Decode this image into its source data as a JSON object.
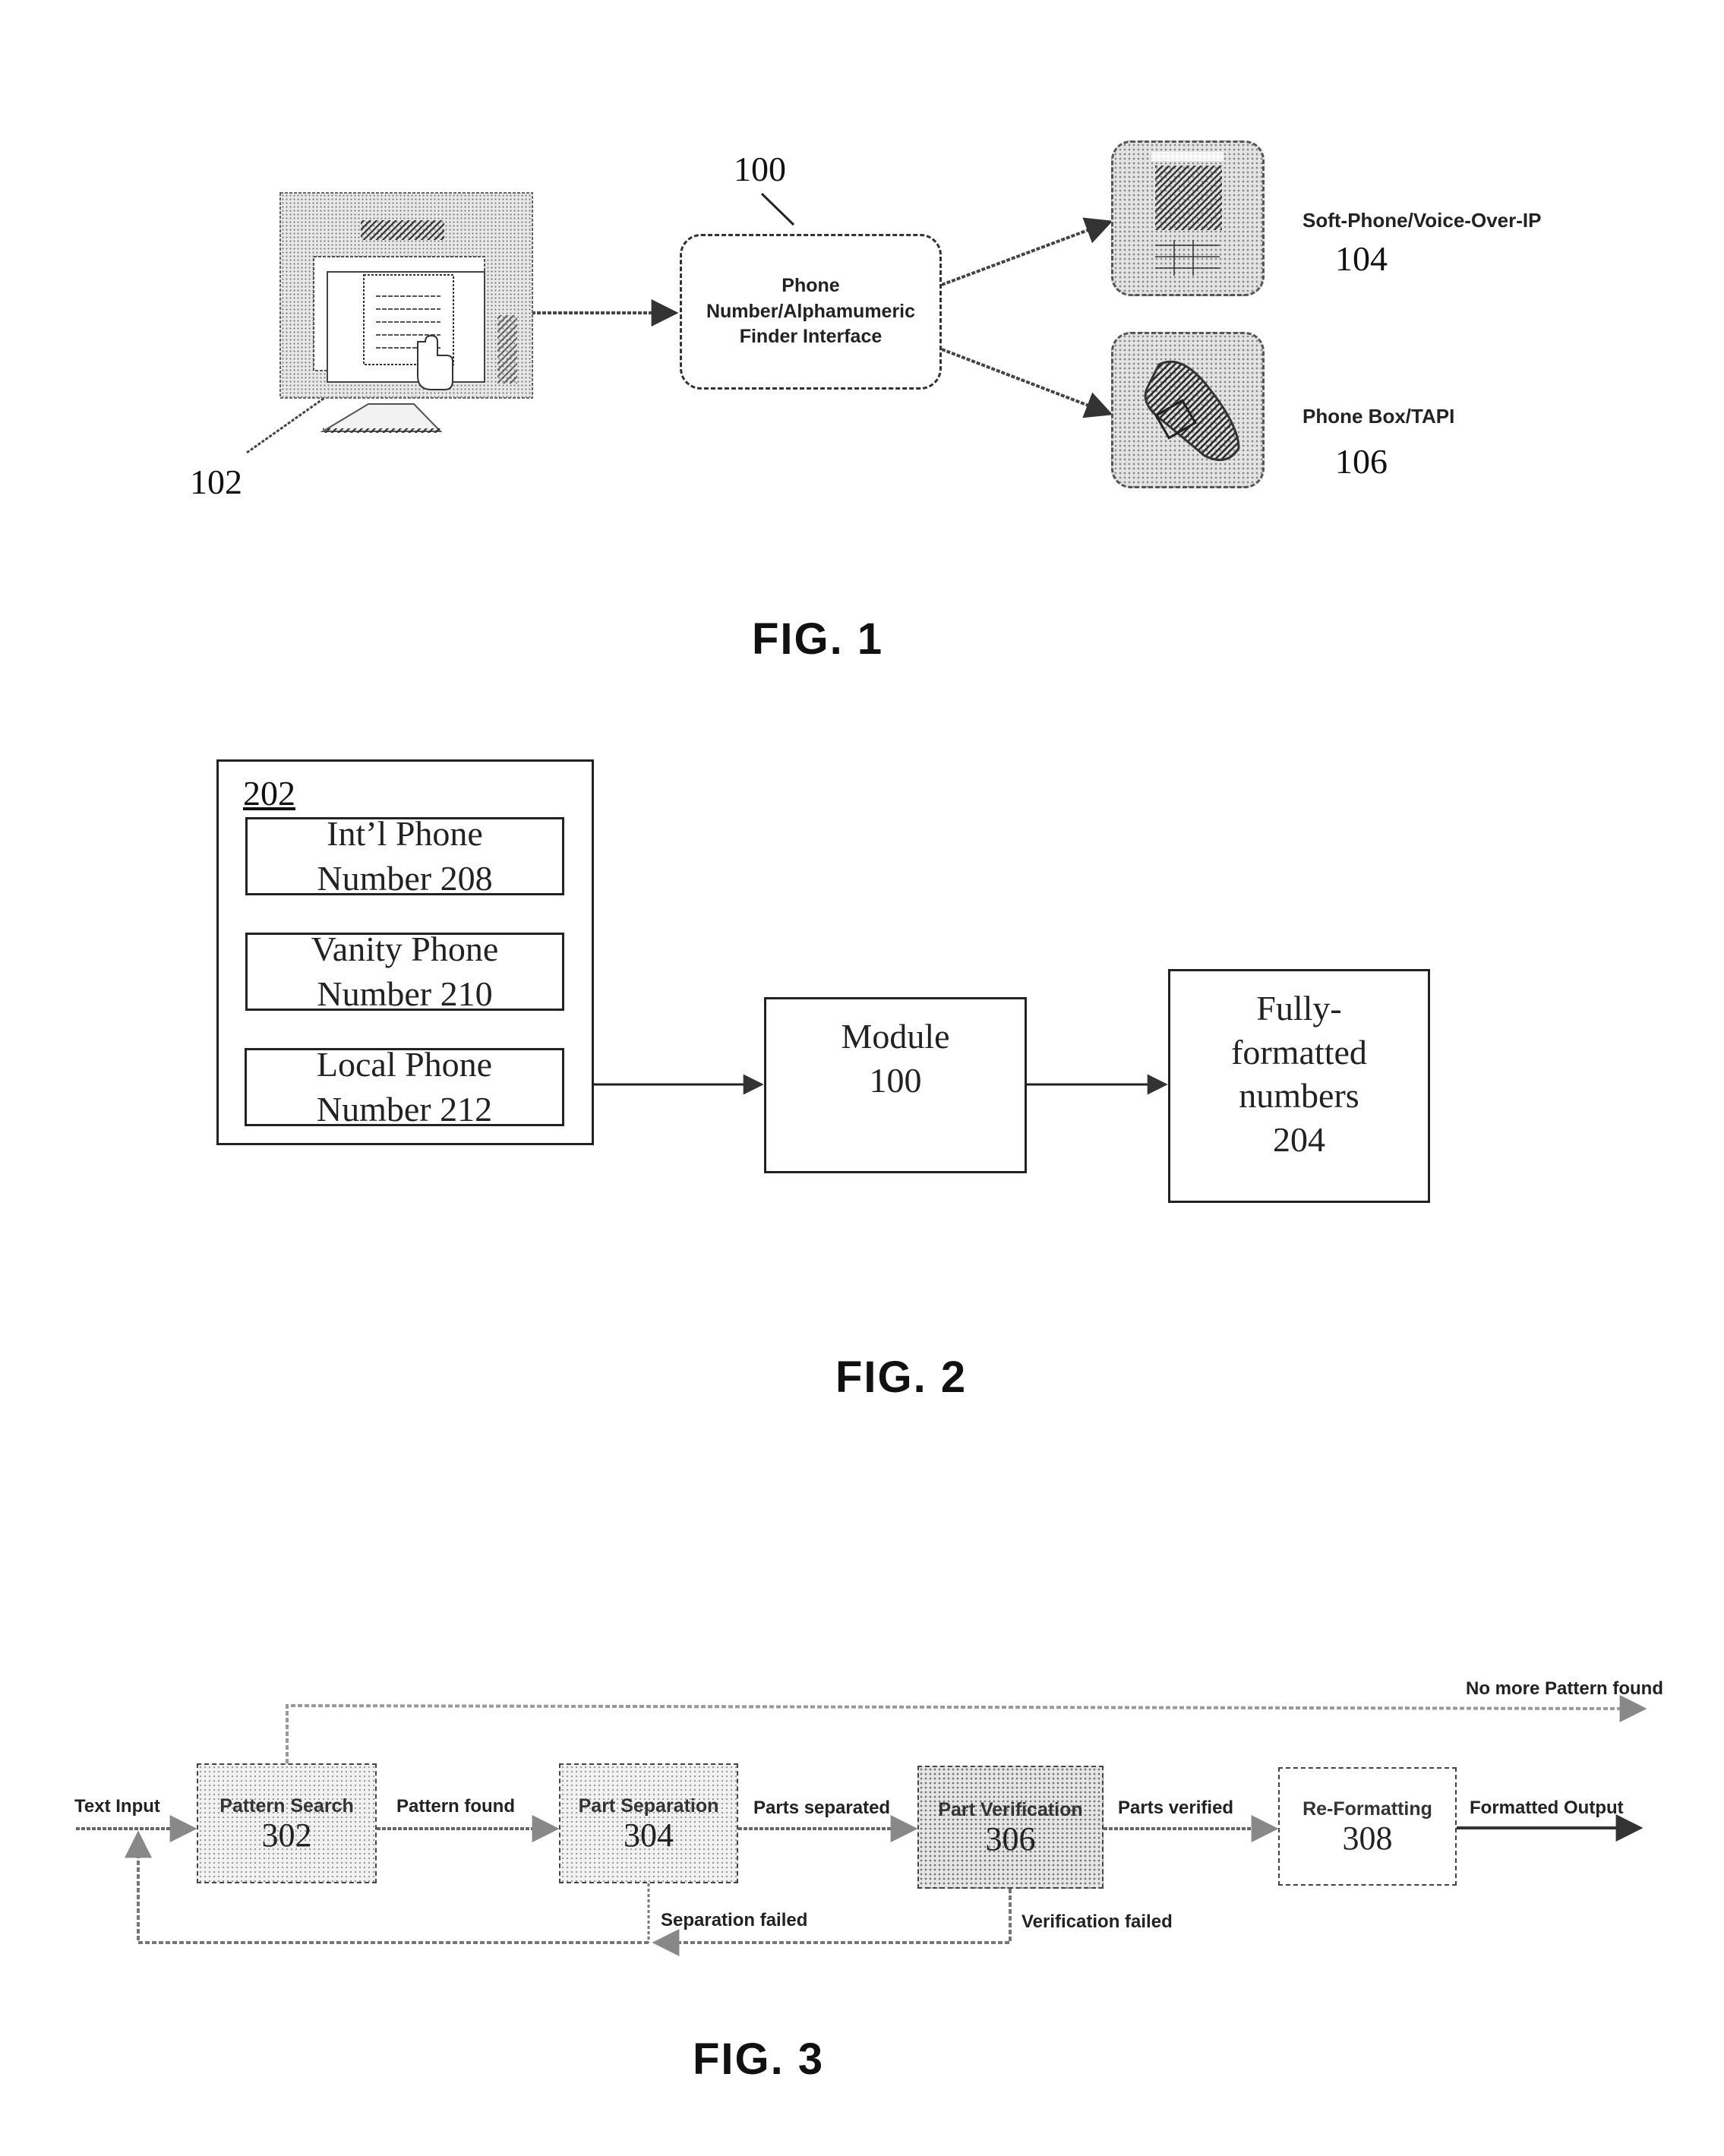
{
  "figures": [
    {
      "id": "fig1",
      "caption": "FIG. 1",
      "computer": {
        "icon": "computer-monitor-with-web-page-icon",
        "ref": "102"
      },
      "interface": {
        "ref": "100",
        "lines": [
          "Phone",
          "Number/Alphamumeric",
          "Finder Interface"
        ]
      },
      "outputs": [
        {
          "icon": "softphone-icon",
          "label": "Soft-Phone/Voice-Over-IP",
          "ref": "104"
        },
        {
          "icon": "desk-telephone-icon",
          "label": "Phone Box/TAPI",
          "ref": "106"
        }
      ]
    },
    {
      "id": "fig2",
      "caption": "FIG. 2",
      "group": {
        "ref": "202",
        "items": [
          {
            "line1": "Int’l Phone",
            "line2": "Number 208"
          },
          {
            "line1": "Vanity Phone",
            "line2": "Number 210"
          },
          {
            "line1": "Local Phone",
            "line2": "Number 212"
          }
        ]
      },
      "module": {
        "line1": "Module",
        "line2": "100"
      },
      "result": {
        "lines": [
          "Fully-",
          "formatted",
          "numbers",
          "204"
        ]
      }
    },
    {
      "id": "fig3",
      "caption": "FIG. 3",
      "input_label": "Text Input",
      "steps": [
        {
          "name": "Pattern Search",
          "ref": "302"
        },
        {
          "name": "Part Separation",
          "ref": "304"
        },
        {
          "name": "Part Verification",
          "ref": "306"
        },
        {
          "name": "Re-Formatting",
          "ref": "308"
        }
      ],
      "transitions": {
        "pattern_found": "Pattern found",
        "parts_separated": "Parts separated",
        "parts_verified": "Parts verified",
        "formatted_output": "Formatted Output",
        "no_more_pattern": "No more Pattern found",
        "separation_failed": "Separation failed",
        "verification_failed": "Verification failed"
      }
    }
  ]
}
